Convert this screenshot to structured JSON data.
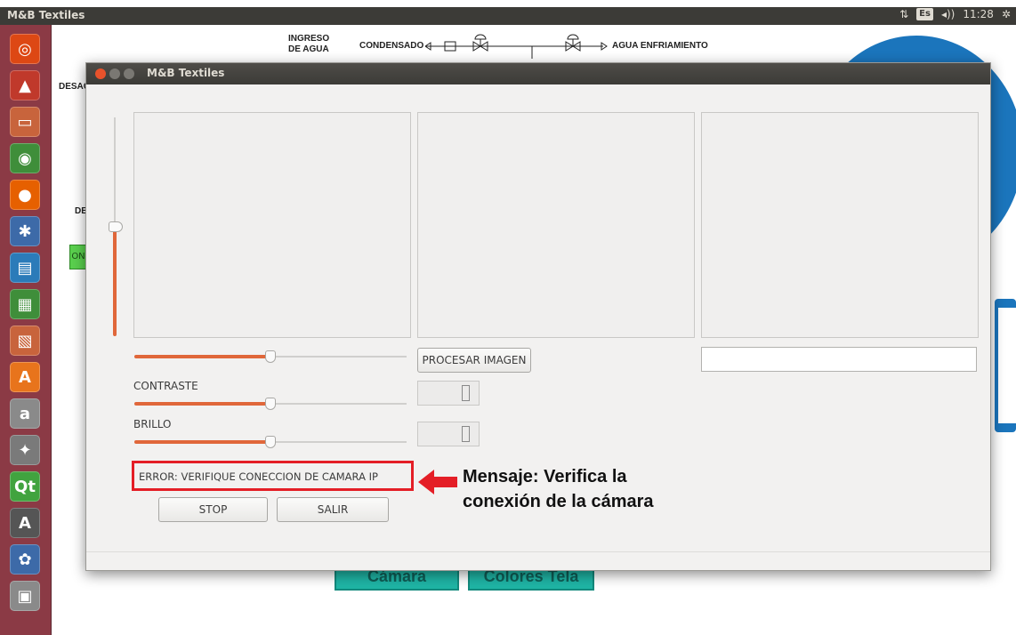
{
  "panel": {
    "app_title": "M&B Textiles",
    "keyboard_layout": "Es",
    "clock": "11:28",
    "network_icon": "network-arrows-icon",
    "sound_icon": "speaker-icon",
    "settings_icon": "gear-icon"
  },
  "launcher": {
    "items": [
      {
        "name": "ubuntu-dash-icon",
        "glyph": "◎",
        "color": "#dd4814"
      },
      {
        "name": "app-icon-1",
        "glyph": "▲",
        "color": "#c0392b"
      },
      {
        "name": "files-icon",
        "glyph": "▭",
        "color": "#c8643c"
      },
      {
        "name": "chrome-icon",
        "glyph": "◉",
        "color": "#3f8e3a"
      },
      {
        "name": "firefox-icon",
        "glyph": "●",
        "color": "#e66000"
      },
      {
        "name": "settings-app-icon",
        "glyph": "✱",
        "color": "#3d6aa8"
      },
      {
        "name": "writer-icon",
        "glyph": "▤",
        "color": "#2b7bb9"
      },
      {
        "name": "calc-icon",
        "glyph": "▦",
        "color": "#3f8e3a"
      },
      {
        "name": "impress-icon",
        "glyph": "▧",
        "color": "#c8643c"
      },
      {
        "name": "software-center-icon",
        "glyph": "A",
        "color": "#e8741c"
      },
      {
        "name": "amazon-icon",
        "glyph": "a",
        "color": "#8a8a8a"
      },
      {
        "name": "system-tools-icon",
        "glyph": "✦",
        "color": "#7a7a7a"
      },
      {
        "name": "qt-creator-icon",
        "glyph": "Qt",
        "color": "#41a33f"
      },
      {
        "name": "update-icon",
        "glyph": "A",
        "color": "#555555"
      },
      {
        "name": "paw-icon",
        "glyph": "✿",
        "color": "#3d6aa8"
      },
      {
        "name": "drive-icon",
        "glyph": "▣",
        "color": "#8a8a8a"
      }
    ]
  },
  "background_app": {
    "diagram_texts": {
      "ingreso": "INGRESO\nDE AGUA",
      "condensado": "CONDENSADO",
      "agua": "AGUA ENFRIAMIENTO",
      "desac": "DESAC",
      "de": "DE",
      "on": "ON"
    },
    "buttons": {
      "camara": "Cámara",
      "colores": "Colores Tela"
    }
  },
  "dialog": {
    "title": "M&B Textiles",
    "process_button": "PROCESAR IMAGEN",
    "contrast_label": "CONTRASTE",
    "brightness_label": "BRILLO",
    "error_message": "ERROR: VERIFIQUE CONECCION DE CAMARA IP",
    "stop_button": "STOP",
    "exit_button": "SALIR",
    "text_field_value": "",
    "contrast_value_display": "0",
    "brightness_value_display": "0",
    "top_slider_level": 0.5,
    "contrast_slider_level": 0.5,
    "brightness_slider_level": 0.5,
    "vertical_slider_level": 0.5
  },
  "annotation": {
    "line1": "Mensaje: Verifica la",
    "line2": "conexión de la cámara",
    "arrow_color": "#e41e26"
  }
}
